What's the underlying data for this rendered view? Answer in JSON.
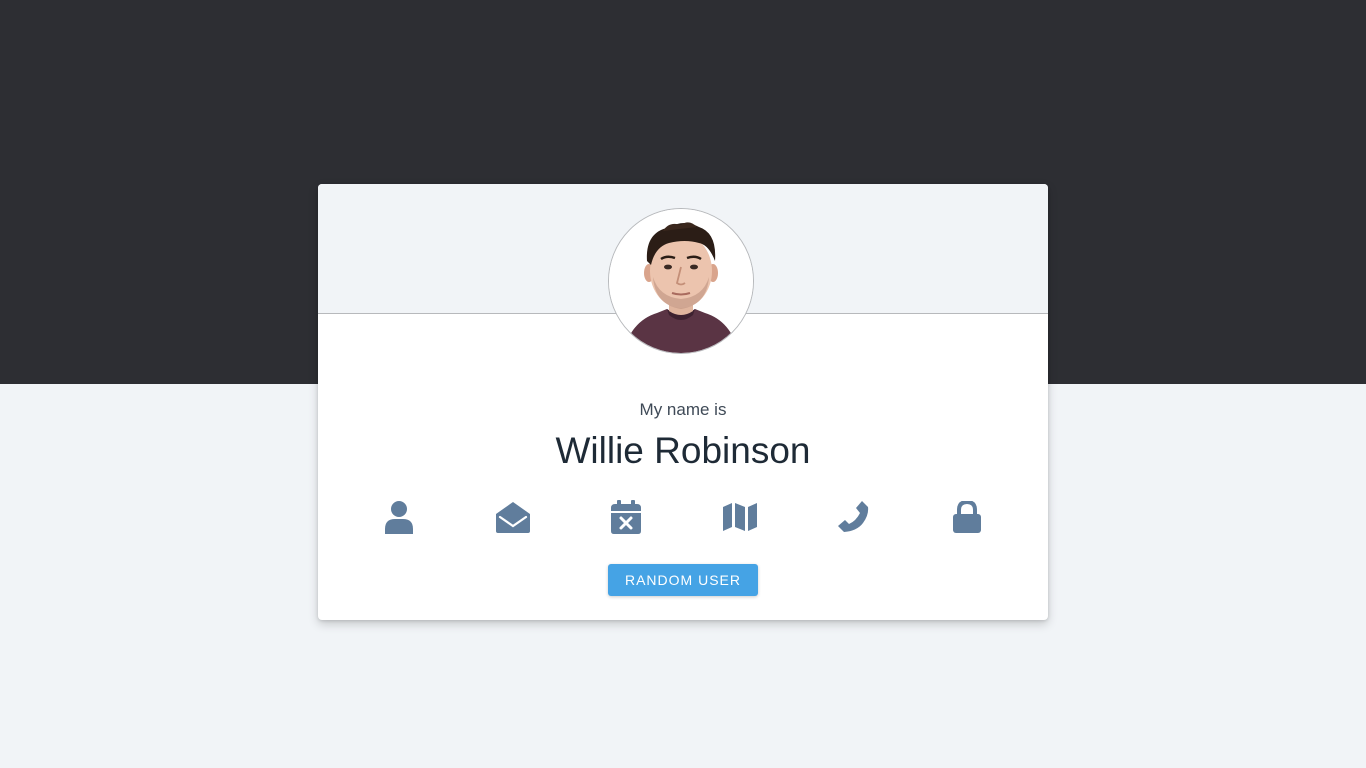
{
  "user": {
    "label": "My name is",
    "value": "Willie Robinson"
  },
  "icons": [
    {
      "name": "user-icon"
    },
    {
      "name": "envelope-open-icon"
    },
    {
      "name": "calendar-x-icon"
    },
    {
      "name": "map-icon"
    },
    {
      "name": "phone-icon"
    },
    {
      "name": "lock-icon"
    }
  ],
  "button": {
    "label": "Random User"
  },
  "colors": {
    "top_band": "#2d2e33",
    "page_bg": "#f1f4f7",
    "icon": "#607d9c",
    "button": "#45a3e5",
    "name_text": "#1e2a36"
  }
}
